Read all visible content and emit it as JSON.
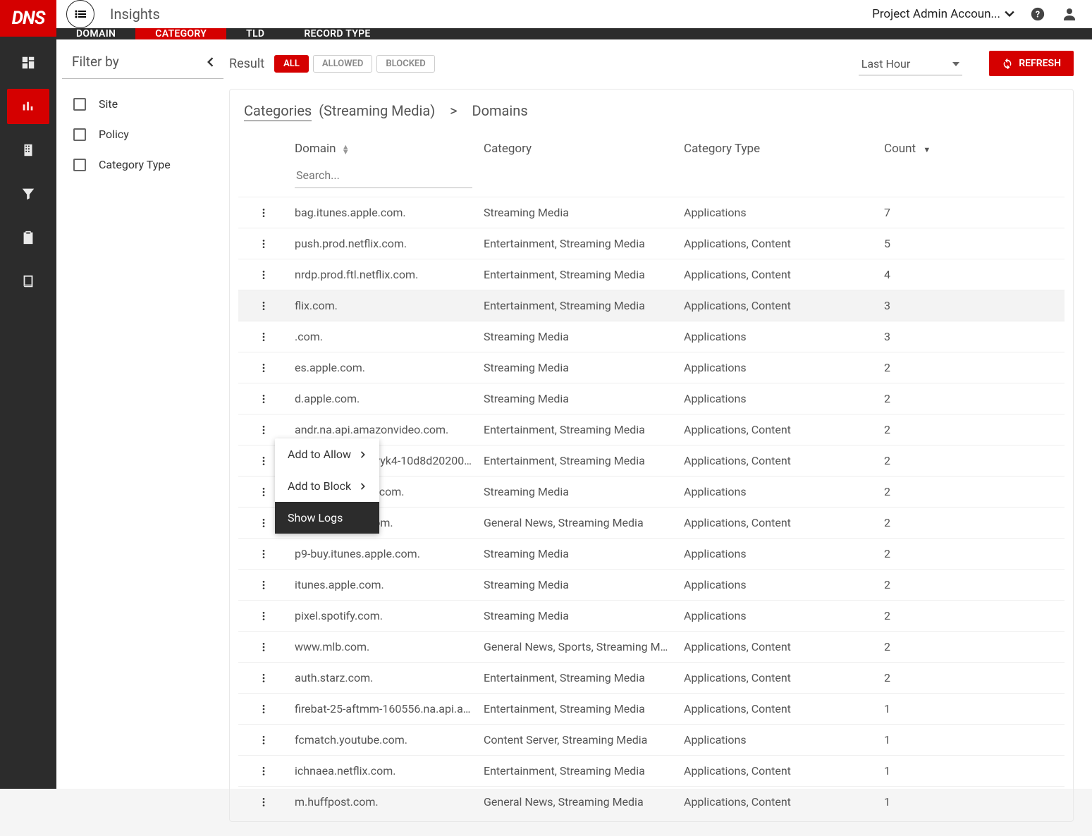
{
  "logo": "DNS",
  "page_title": "Insights",
  "account_selector": "Project Admin Accoun...",
  "tabs": [
    "DOMAIN",
    "CATEGORY",
    "TLD",
    "RECORD TYPE"
  ],
  "active_tab": 1,
  "filter": {
    "title": "Filter by",
    "items": [
      "Site",
      "Policy",
      "Category Type"
    ]
  },
  "results": {
    "label": "Result",
    "pills": [
      "ALL",
      "ALLOWED",
      "BLOCKED"
    ],
    "active_pill": 0,
    "time_range": "Last Hour",
    "refresh": "REFRESH"
  },
  "breadcrumb": {
    "link": "Categories",
    "link_suffix": "(Streaming Media)",
    "current": "Domains"
  },
  "table": {
    "headers": {
      "domain": "Domain",
      "category": "Category",
      "category_type": "Category Type",
      "count": "Count"
    },
    "search_placeholder": "Search...",
    "rows": [
      {
        "domain": "bag.itunes.apple.com.",
        "category": "Streaming Media",
        "ctype": "Applications",
        "count": "7"
      },
      {
        "domain": "push.prod.netflix.com.",
        "category": "Entertainment, Streaming Media",
        "ctype": "Applications, Content",
        "count": "5"
      },
      {
        "domain": "nrdp.prod.ftl.netflix.com.",
        "category": "Entertainment, Streaming Media",
        "ctype": "Applications, Content",
        "count": "4"
      },
      {
        "domain": "flix.com.",
        "category": "Entertainment, Streaming Media",
        "ctype": "Applications, Content",
        "count": "3",
        "highlight": true
      },
      {
        "domain": ".com.",
        "category": "Streaming Media",
        "ctype": "Applications",
        "count": "3"
      },
      {
        "domain": "es.apple.com.",
        "category": "Streaming Media",
        "ctype": "Applications",
        "count": "2"
      },
      {
        "domain": "d.apple.com.",
        "category": "Streaming Media",
        "ctype": "Applications",
        "count": "2"
      },
      {
        "domain": "andr.na.api.amazonvideo.com.",
        "category": "Entertainment, Streaming Media",
        "ctype": "Applications, Content",
        "count": "2"
      },
      {
        "domain": "avlrc-aydgjrhm5vyk4-10d8d2020051207...",
        "category": "Entertainment, Streaming Media",
        "ctype": "Applications, Content",
        "count": "2"
      },
      {
        "domain": "buy.itunes.apple.com.",
        "category": "Streaming Media",
        "ctype": "Applications",
        "count": "2"
      },
      {
        "domain": "www.huffpost.com.",
        "category": "General News, Streaming Media",
        "ctype": "Applications, Content",
        "count": "2"
      },
      {
        "domain": "p9-buy.itunes.apple.com.",
        "category": "Streaming Media",
        "ctype": "Applications",
        "count": "2"
      },
      {
        "domain": "itunes.apple.com.",
        "category": "Streaming Media",
        "ctype": "Applications",
        "count": "2"
      },
      {
        "domain": "pixel.spotify.com.",
        "category": "Streaming Media",
        "ctype": "Applications",
        "count": "2"
      },
      {
        "domain": "www.mlb.com.",
        "category": "General News, Sports, Streaming Media",
        "ctype": "Applications, Content",
        "count": "2"
      },
      {
        "domain": "auth.starz.com.",
        "category": "Entertainment, Streaming Media",
        "ctype": "Applications, Content",
        "count": "2"
      },
      {
        "domain": "firebat-25-aftmm-160556.na.api.amazon...",
        "category": "Entertainment, Streaming Media",
        "ctype": "Applications, Content",
        "count": "1"
      },
      {
        "domain": "fcmatch.youtube.com.",
        "category": "Content Server, Streaming Media",
        "ctype": "Applications",
        "count": "1"
      },
      {
        "domain": "ichnaea.netflix.com.",
        "category": "Entertainment, Streaming Media",
        "ctype": "Applications, Content",
        "count": "1"
      },
      {
        "domain": "m.huffpost.com.",
        "category": "General News, Streaming Media",
        "ctype": "Applications, Content",
        "count": "1"
      }
    ]
  },
  "context_menu": {
    "allow": "Add to Allow",
    "block": "Add to Block",
    "logs": "Show Logs"
  }
}
